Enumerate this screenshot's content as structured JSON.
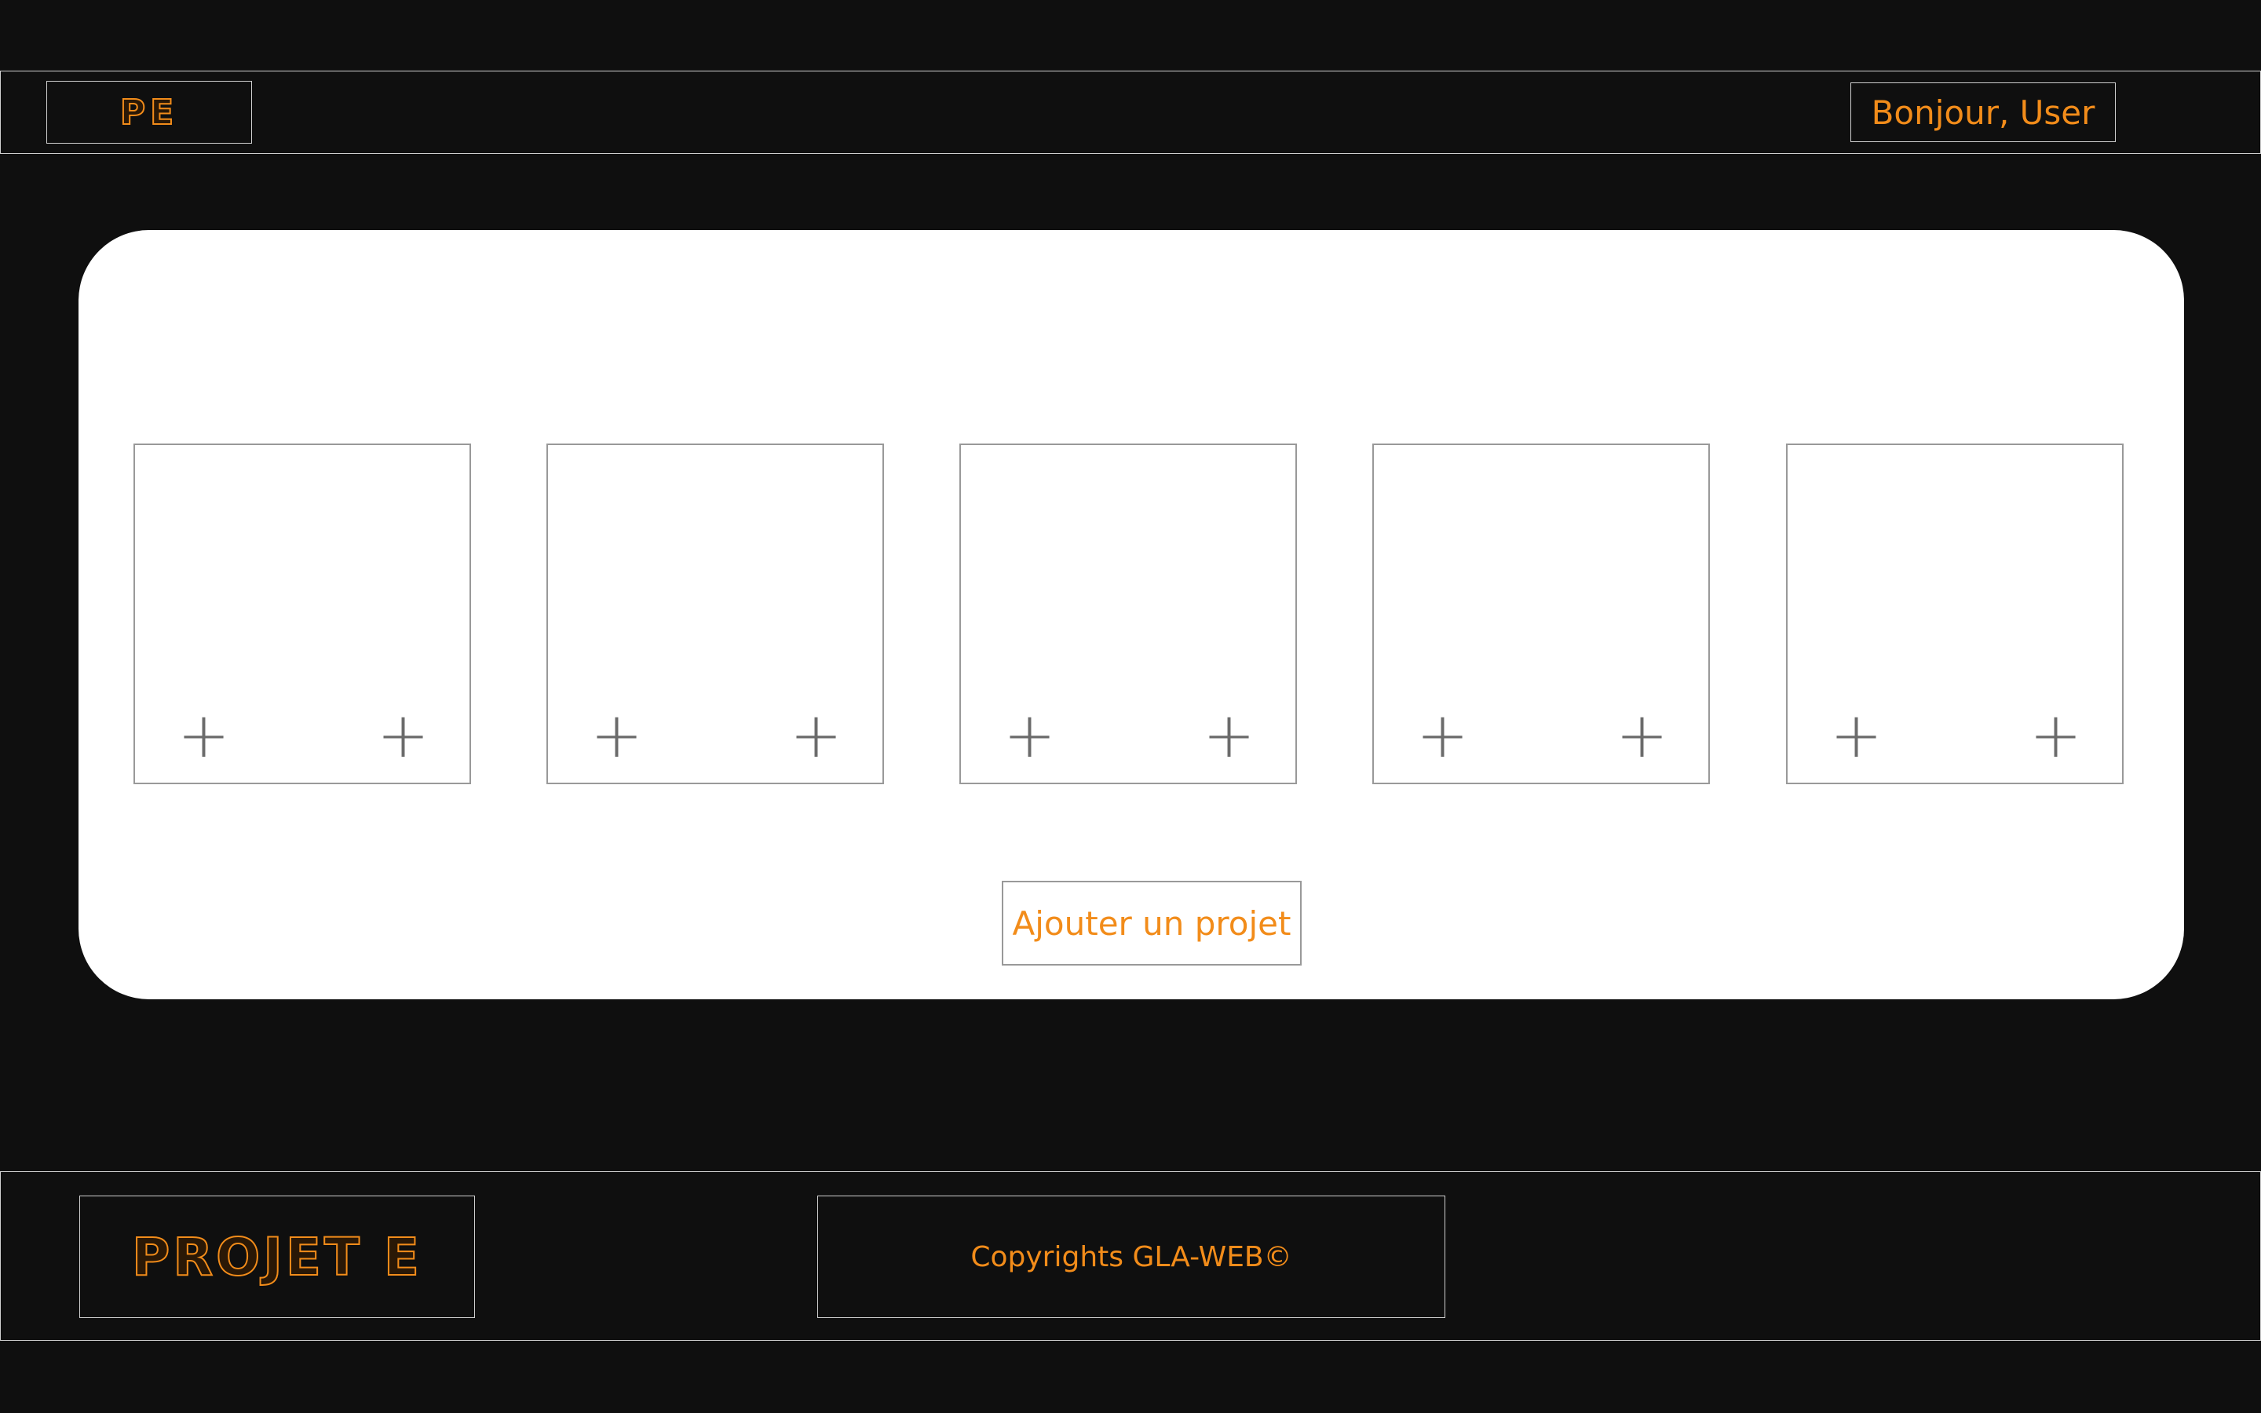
{
  "header": {
    "logo_text": "PE",
    "greeting": "Bonjour, User"
  },
  "main": {
    "cards": [
      {
        "left_action": "+",
        "right_action": "+"
      },
      {
        "left_action": "+",
        "right_action": "+"
      },
      {
        "left_action": "+",
        "right_action": "+"
      },
      {
        "left_action": "+",
        "right_action": "+"
      },
      {
        "left_action": "+",
        "right_action": "+"
      }
    ],
    "add_project_label": "Ajouter un projet"
  },
  "footer": {
    "logo_text": "PROJET E",
    "copyright": "Copyrights GLA-WEB©"
  },
  "colors": {
    "background": "#0f0f0f",
    "accent": "#f28c1a",
    "panel": "#ffffff",
    "border": "#cfcfcf",
    "icon": "#6b6b6b"
  }
}
